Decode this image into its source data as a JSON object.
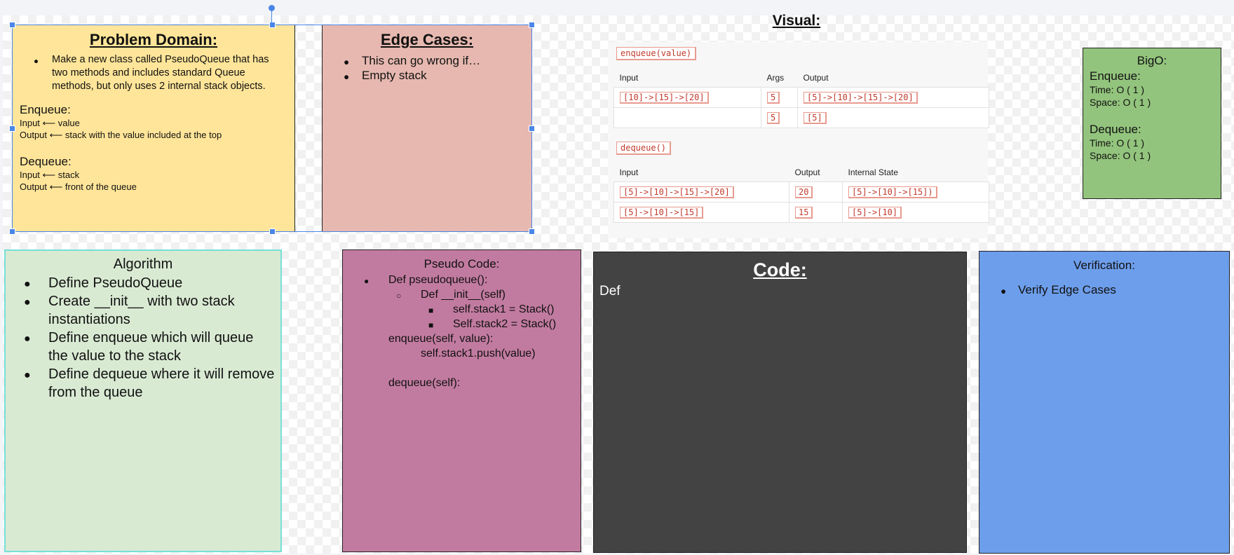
{
  "problem_domain": {
    "title": "Problem Domain:",
    "bullet": "Make a new class called PseudoQueue that has two methods and includes standard Queue methods, but only uses 2 internal stack objects.",
    "enqueue": {
      "heading": "Enqueue:",
      "input": "Input ⟵ value",
      "output": "Output ⟵ stack with the value included at the top"
    },
    "dequeue": {
      "heading": "Dequeue:",
      "input": "Input ⟵ stack",
      "output": "Output ⟵ front of the queue"
    }
  },
  "edge_cases": {
    "title": "Edge Cases:",
    "items": [
      "This can go wrong if…",
      "Empty stack"
    ]
  },
  "visual": {
    "title": "Visual:",
    "enqueue_tag": "enqueue(value)",
    "enqueue_headers": [
      "Input",
      "Args",
      "Output"
    ],
    "enqueue_rows": [
      [
        "[10]->[15]->[20]",
        "5",
        "[5]->[10]->[15]->[20]"
      ],
      [
        "",
        "5",
        "[5]"
      ]
    ],
    "dequeue_tag": "dequeue()",
    "dequeue_headers": [
      "Input",
      "Output",
      "Internal State"
    ],
    "dequeue_rows": [
      [
        "[5]->[10]->[15]->[20]",
        "20",
        "[5]->[10]->[15])"
      ],
      [
        "[5]->[10]->[15]",
        "15",
        "[5]->[10]"
      ]
    ]
  },
  "bigo": {
    "title": "BigO:",
    "enqueue": {
      "heading": "Enqueue:",
      "time": "Time: O ( 1 )",
      "space": "Space: O ( 1 )"
    },
    "dequeue": {
      "heading": "Dequeue:",
      "time": "Time: O ( 1 )",
      "space": "Space: O ( 1 )"
    }
  },
  "algorithm": {
    "title": "Algorithm",
    "items": [
      "Define PseudoQueue",
      "Create __init__ with two stack instantiations",
      "Define enqueue which will queue the value to the stack",
      "Define dequeue where it will remove from the queue"
    ]
  },
  "pseudo_code": {
    "title": "Pseudo Code:",
    "lines": [
      "Def pseudoqueue():",
      "Def __init__(self)",
      "self.stack1 = Stack()",
      "Self.stack2 = Stack()",
      "enqueue(self, value):",
      "self.stack1.push(value)",
      "dequeue(self):"
    ]
  },
  "code": {
    "title": "Code:",
    "body": "Def"
  },
  "verification": {
    "title": "Verification:",
    "items": [
      "Verify Edge Cases"
    ]
  },
  "colors": {
    "problem_domain": "#ffe599",
    "edge_cases": "#e6b8af",
    "bigo": "#93c47d",
    "algorithm": "#d9ead3",
    "pseudo_code": "#c27ba0",
    "code": "#434343",
    "verification": "#6d9eeb",
    "selection": "#4a86e8"
  }
}
